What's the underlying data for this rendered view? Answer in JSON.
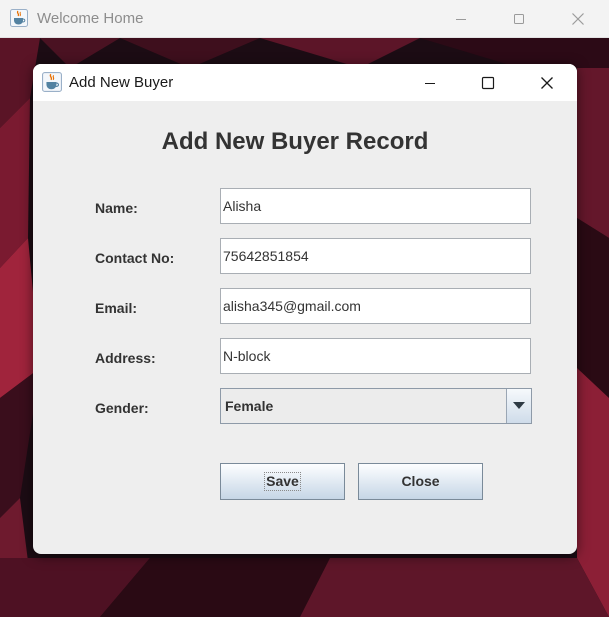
{
  "outer_window": {
    "title": "Welcome Home"
  },
  "dialog": {
    "title": "Add New Buyer",
    "heading": "Add New Buyer Record",
    "fields": {
      "name": {
        "label": "Name:",
        "value": "Alisha"
      },
      "contact": {
        "label": "Contact No:",
        "value": "75642851854"
      },
      "email": {
        "label": "Email:",
        "value": "alisha345@gmail.com"
      },
      "address": {
        "label": "Address:",
        "value": "N-block"
      },
      "gender": {
        "label": "Gender:",
        "selected": "Female"
      }
    },
    "buttons": {
      "save": "Save",
      "close": "Close"
    }
  },
  "colors": {
    "backdrop_dark": "#1c0c14",
    "backdrop_red": "#a0243c",
    "java_cup_orange": "#e76f00",
    "java_cup_blue": "#5382a1"
  },
  "icons": [
    "java-app-icon",
    "minimize-icon",
    "maximize-icon",
    "close-icon",
    "chevron-down-icon"
  ]
}
